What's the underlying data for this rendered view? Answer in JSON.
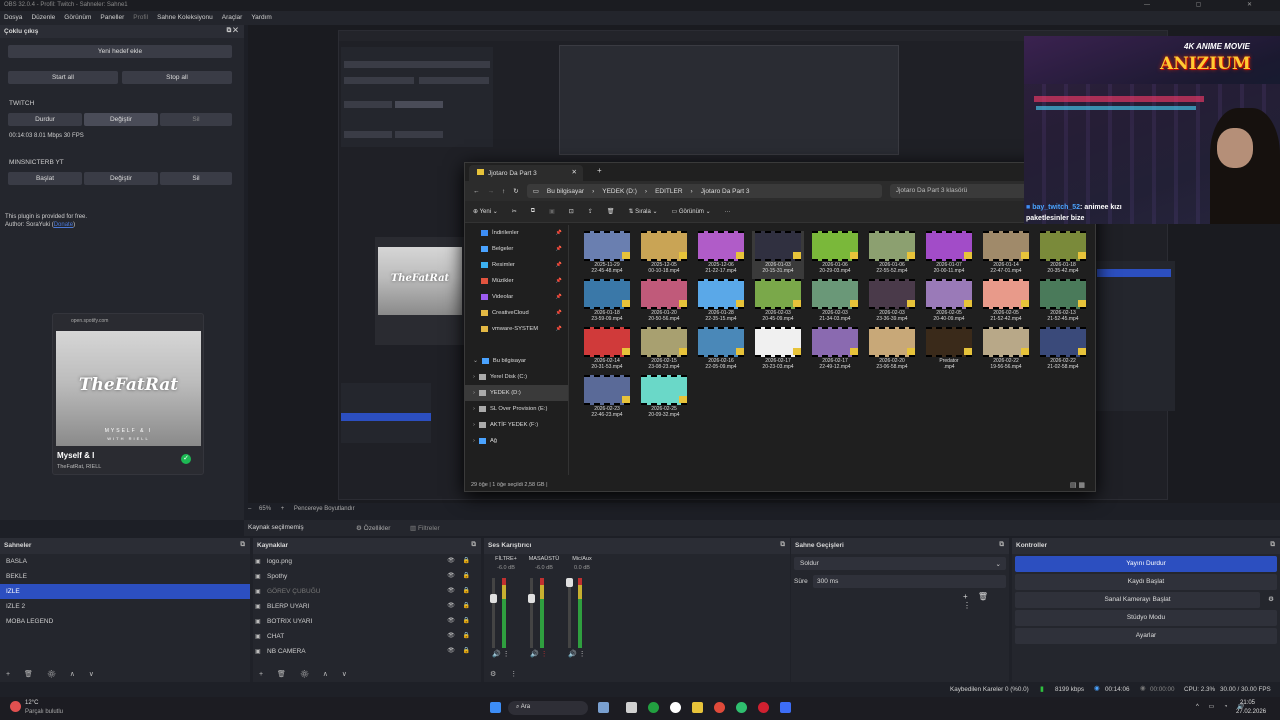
{
  "window": {
    "title": "OBS 32.0.4 - Profil: Twitch - Sahneler: Sahne1",
    "menu": [
      "Dosya",
      "Düzenle",
      "Görünüm",
      "Paneller",
      "Profil",
      "Sahne Koleksiyonu",
      "Araçlar",
      "Yardım"
    ]
  },
  "multi_output": {
    "title": "Çoklu çıkış",
    "add_target": "Yeni hedef ekle",
    "start_all": "Start all",
    "stop_all": "Stop all",
    "targets": [
      {
        "name": "TWITCH",
        "b1": "Durdur",
        "b2": "Değiştir",
        "b3": "Sil",
        "stats": "00:14:03  8.01 Mbps  30 FPS"
      },
      {
        "name": "MINSNICTERB YT",
        "b1": "Başlat",
        "b2": "Değiştir",
        "b3": "Sil",
        "stats": ""
      }
    ],
    "note": "This plugin is provided for free.",
    "author_prefix": "Author: SoraYuki (",
    "author_link": "Donate",
    "author_suffix": ")"
  },
  "spotify_card": {
    "url": "open.spotify.com",
    "art_title": "TheFatRat",
    "art_sub": "MYSELF & I",
    "art_sub2": "WITH RIELL",
    "song": "Myself & I",
    "artist": "TheFatRat, RIELL",
    "status_color": "#1db954"
  },
  "preview_toolbar": {
    "zoom": "65%",
    "fit": "Pencereye Boyutlandır"
  },
  "explorer": {
    "tab": "Jjotaro Da Part 3",
    "crumbs": [
      "Bu bilgisayar",
      "YEDEK (D:)",
      "EDITLER",
      "Jjotaro Da Part 3"
    ],
    "search": "Jjotaro Da Part 3 klasörü",
    "cmd": {
      "new": "Yeni",
      "sort": "Sırala",
      "view": "Görünüm"
    },
    "nav": [
      {
        "label": "İndirilenler",
        "pin": true,
        "color": "#3d8df5"
      },
      {
        "label": "Belgeler",
        "pin": true,
        "color": "#4aa3ff"
      },
      {
        "label": "Resimler",
        "pin": true,
        "color": "#3bb0f0"
      },
      {
        "label": "Müzikler",
        "pin": true,
        "color": "#e2543f"
      },
      {
        "label": "Videolar",
        "pin": true,
        "color": "#9c5cf0"
      },
      {
        "label": "CreativeCloud",
        "pin": true,
        "color": "#e3b844"
      },
      {
        "label": "vmware-SYSTEM",
        "pin": true,
        "color": "#e3b844"
      },
      {
        "label": "",
        "pin": false,
        "color": ""
      },
      {
        "label": "Bu bilgisayar",
        "pin": false,
        "color": "#4aa3ff"
      },
      {
        "label": "Yerel Disk (C:)",
        "pin": false,
        "color": "#aaaaaa"
      },
      {
        "label": "YEDEK (D:)",
        "pin": false,
        "color": "#aaaaaa"
      },
      {
        "label": "SL Over Provision (E:)",
        "pin": false,
        "color": "#aaaaaa"
      },
      {
        "label": "AKTİF YEDEK (F:)",
        "pin": false,
        "color": "#aaaaaa"
      },
      {
        "label": "Ağ",
        "pin": false,
        "color": "#4aa3ff"
      }
    ],
    "files": [
      {
        "l1": "2025-11-29",
        "l2": "22-45-48.mp4",
        "c": "#6a7fb0"
      },
      {
        "l1": "2025-12-05",
        "l2": "00-10-18.mp4",
        "c": "#c9a455"
      },
      {
        "l1": "2025-12-06",
        "l2": "21-22-17.mp4",
        "c": "#b05cc8"
      },
      {
        "l1": "2026-01-03",
        "l2": "20-15-31.mp4",
        "c": "#303040"
      },
      {
        "l1": "2026-01-06",
        "l2": "20-29-03.mp4",
        "c": "#7ab83a"
      },
      {
        "l1": "2026-01-06",
        "l2": "22-55-52.mp4",
        "c": "#8ca070"
      },
      {
        "l1": "2026-01-07",
        "l2": "20-00-11.mp4",
        "c": "#a24cc8"
      },
      {
        "l1": "2026-01-14",
        "l2": "22-47-01.mp4",
        "c": "#a08a6a"
      },
      {
        "l1": "2026-01-18",
        "l2": "20-35-42.mp4",
        "c": "#7a8a3a"
      },
      {
        "l1": "2026-01-18",
        "l2": "23-59-09.mp4",
        "c": "#3a78a8"
      },
      {
        "l1": "2026-01-20",
        "l2": "20-50-56.mp4",
        "c": "#c05a7a"
      },
      {
        "l1": "2026-01-28",
        "l2": "22-35-15.mp4",
        "c": "#5aa8e8"
      },
      {
        "l1": "2026-02-03",
        "l2": "20-45-09.mp4",
        "c": "#7aa84a"
      },
      {
        "l1": "2026-02-03",
        "l2": "21-34-03.mp4",
        "c": "#6a9878"
      },
      {
        "l1": "2026-02-03",
        "l2": "23-36-39.mp4",
        "c": "#4a3a4a"
      },
      {
        "l1": "2026-02-05",
        "l2": "20-40-09.mp4",
        "c": "#9a7ab8"
      },
      {
        "l1": "2026-02-05",
        "l2": "21-52-42.mp4",
        "c": "#e89a8a"
      },
      {
        "l1": "2026-02-13",
        "l2": "21-52-45.mp4",
        "c": "#4a7a5a"
      },
      {
        "l1": "2026-02-14",
        "l2": "20-31-53.mp4",
        "c": "#d03a3a"
      },
      {
        "l1": "2026-02-15",
        "l2": "23-08-23.mp4",
        "c": "#a8a070"
      },
      {
        "l1": "2026-02-16",
        "l2": "22-05-09.mp4",
        "c": "#4a88b8"
      },
      {
        "l1": "2026-02-17",
        "l2": "20-23-03.mp4",
        "c": "#f0f0f0"
      },
      {
        "l1": "2026-02-17",
        "l2": "22-49-12.mp4",
        "c": "#8a6ab0"
      },
      {
        "l1": "2026-02-20",
        "l2": "23-06-58.mp4",
        "c": "#c8a878"
      },
      {
        "l1": "Predator",
        "l2": ".mp4",
        "c": "#3a2a1a"
      },
      {
        "l1": "2026-02-22",
        "l2": "19-56-56.mp4",
        "c": "#b8a888"
      },
      {
        "l1": "2026-02-22",
        "l2": "21-02-58.mp4",
        "c": "#3a4a7a"
      },
      {
        "l1": "2026-02-23",
        "l2": "22-46-23.mp4",
        "c": "#5a6a98"
      },
      {
        "l1": "2026-02-25",
        "l2": "20-09-32.mp4",
        "c": "#6ad8c8"
      }
    ],
    "status": "29 öğe   |   1 öğe seçildi  2,58 GB   |"
  },
  "webcam": {
    "brand": "ANIZIUM",
    "tagline": "4K ANIME MOVIE",
    "chat_user": "bay_twitch_52",
    "chat_msg": ": animeе kızı paketlesinler bize"
  },
  "context_bar": {
    "none_selected": "Kaynak seçilmemiş",
    "props": "Özellikler",
    "filters": "Filtreler"
  },
  "scenes": {
    "title": "Sahneler",
    "items": [
      "BASLA",
      "BEKLE",
      "IZLE",
      "IZLE 2",
      "MOBA LEGEND"
    ],
    "selected_index": 2
  },
  "sources": {
    "title": "Kaynaklar",
    "items": [
      {
        "name": "logo.png",
        "icon": "image-icon"
      },
      {
        "name": "Spothy",
        "icon": "window-icon"
      },
      {
        "name": "GÖREV ÇUBUĞU",
        "icon": "window-icon"
      },
      {
        "name": "BLERP UYARI",
        "icon": "browser-icon"
      },
      {
        "name": "BOTRIX UYARI",
        "icon": "browser-icon"
      },
      {
        "name": "CHAT",
        "icon": "browser-icon"
      },
      {
        "name": "NB CAMERA",
        "icon": "camera-icon"
      }
    ]
  },
  "mixer": {
    "title": "Ses Karıştırıcı",
    "channels": [
      {
        "name": "FİLTRE+",
        "db": "-6.0 dB"
      },
      {
        "name": "MASAÜSTÜ",
        "db": "-6.0 dB"
      },
      {
        "name": "Mic/Aux",
        "db": "0.0 dB"
      }
    ]
  },
  "transitions": {
    "title": "Sahne Geçişleri",
    "type": "Soldur",
    "duration_label": "Süre",
    "duration": "300 ms"
  },
  "controls": {
    "title": "Kontroller",
    "buttons": [
      "Yayını Durdur",
      "Kaydı Başlat",
      "Sanal Kamerayı Başlat",
      "Stüdyo Modu",
      "Ayarlar"
    ]
  },
  "statusbar": {
    "dropped": "Kaybedilen Kareler 0 (%0.0)",
    "kbps": "8199 kbps",
    "stream_time": "00:14:06",
    "rec_time": "00:00:00",
    "cpu": "CPU: 2.3%",
    "fps": "30.00 / 30.00 FPS"
  },
  "taskbar": {
    "weather_temp": "12°C",
    "weather_desc": "Parçalı bulutlu",
    "search": "Ara",
    "time": "21:05",
    "date": "27.02.2026"
  },
  "colors": {
    "accent": "#2c4fc0",
    "folder": "#e7c33a",
    "live_green": "#2fbf3f"
  }
}
